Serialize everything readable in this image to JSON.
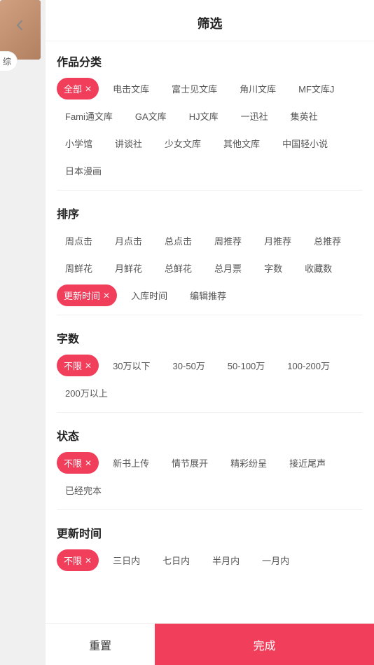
{
  "header": {
    "title": "筛选",
    "back_icon": "‹"
  },
  "sections": {
    "category": {
      "title": "作品分类",
      "tags": [
        {
          "label": "全部",
          "active": true
        },
        {
          "label": "电击文库",
          "active": false
        },
        {
          "label": "富士见文库",
          "active": false
        },
        {
          "label": "角川文库",
          "active": false
        },
        {
          "label": "MF文库J",
          "active": false
        },
        {
          "label": "Fami通文库",
          "active": false
        },
        {
          "label": "GA文库",
          "active": false
        },
        {
          "label": "HJ文库",
          "active": false
        },
        {
          "label": "一迅社",
          "active": false
        },
        {
          "label": "集英社",
          "active": false
        },
        {
          "label": "小学馆",
          "active": false
        },
        {
          "label": "讲谈社",
          "active": false
        },
        {
          "label": "少女文库",
          "active": false
        },
        {
          "label": "其他文库",
          "active": false
        },
        {
          "label": "中国轻小说",
          "active": false
        },
        {
          "label": "日本漫画",
          "active": false
        }
      ]
    },
    "sort": {
      "title": "排序",
      "tags": [
        {
          "label": "周点击",
          "active": false
        },
        {
          "label": "月点击",
          "active": false
        },
        {
          "label": "总点击",
          "active": false
        },
        {
          "label": "周推荐",
          "active": false
        },
        {
          "label": "月推荐",
          "active": false
        },
        {
          "label": "总推荐",
          "active": false
        },
        {
          "label": "周鲜花",
          "active": false
        },
        {
          "label": "月鲜花",
          "active": false
        },
        {
          "label": "总鲜花",
          "active": false
        },
        {
          "label": "总月票",
          "active": false
        },
        {
          "label": "字数",
          "active": false
        },
        {
          "label": "收藏数",
          "active": false
        },
        {
          "label": "更新时间",
          "active": true
        },
        {
          "label": "入库时间",
          "active": false
        },
        {
          "label": "编辑推荐",
          "active": false
        }
      ]
    },
    "word_count": {
      "title": "字数",
      "tags": [
        {
          "label": "不限",
          "active": true
        },
        {
          "label": "30万以下",
          "active": false
        },
        {
          "label": "30-50万",
          "active": false
        },
        {
          "label": "50-100万",
          "active": false
        },
        {
          "label": "100-200万",
          "active": false
        },
        {
          "label": "200万以上",
          "active": false
        }
      ]
    },
    "status": {
      "title": "状态",
      "tags": [
        {
          "label": "不限",
          "active": true
        },
        {
          "label": "新书上传",
          "active": false
        },
        {
          "label": "情节展开",
          "active": false
        },
        {
          "label": "精彩纷呈",
          "active": false
        },
        {
          "label": "接近尾声",
          "active": false
        },
        {
          "label": "已经完本",
          "active": false
        }
      ]
    },
    "update_time": {
      "title": "更新时间",
      "tags": [
        {
          "label": "不限",
          "active": true
        },
        {
          "label": "三日内",
          "active": false
        },
        {
          "label": "七日内",
          "active": false
        },
        {
          "label": "半月内",
          "active": false
        },
        {
          "label": "一月内",
          "active": false
        }
      ]
    }
  },
  "footer": {
    "reset_label": "重置",
    "confirm_label": "完成"
  },
  "tab": {
    "label": "综"
  },
  "colors": {
    "accent": "#f03e5b"
  }
}
